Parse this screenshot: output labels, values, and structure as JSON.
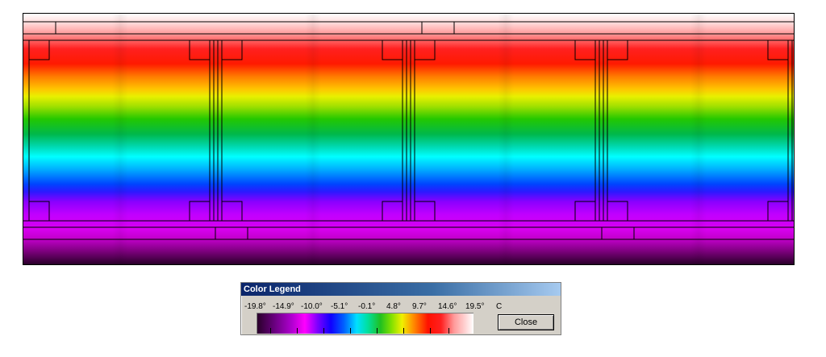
{
  "legend": {
    "title": "Color Legend",
    "unit": "C",
    "close_label": "Close",
    "tick_labels": [
      "-19.8°",
      "-14.9°",
      "-10.0°",
      "-5.1°",
      "-0.1°",
      "4.8°",
      "9.7°",
      "14.6°",
      "19.5°"
    ]
  }
}
